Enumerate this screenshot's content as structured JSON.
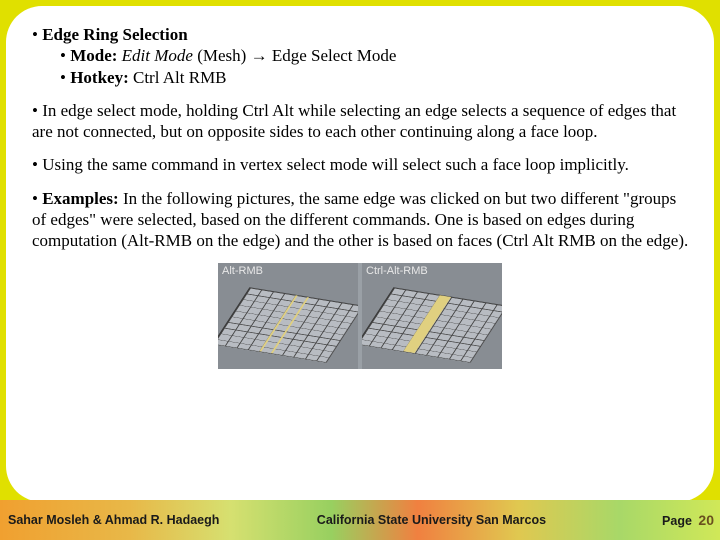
{
  "slide": {
    "b1_title": "Edge Ring Selection",
    "b1_sub1_label": "Mode:",
    "b1_sub1_emph": "Edit Mode",
    "b1_sub1_rest": "(Mesh) → Edge Select Mode",
    "b1_sub2_label": "Hotkey:",
    "b1_sub2_rest": "Ctrl  Alt  RMB",
    "b2": "In edge select mode, holding Ctrl Alt while selecting an edge selects a sequence of edges that are not connected, but on opposite sides to each other continuing along a face loop.",
    "b3": "Using the same command in vertex select mode will select such a face loop implicitly.",
    "b4_label": "Examples:",
    "b4_rest": "In the following pictures, the same edge was clicked on but two different \"groups of edges\" were selected, based on the different commands. One is based on edges during computation (Alt-RMB on the edge) and the other is based on faces (Ctrl Alt RMB on the edge).",
    "fig_panel_left": "Alt-RMB",
    "fig_panel_right": "Ctrl-Alt-RMB"
  },
  "footer": {
    "left": "Sahar Mosleh & Ahmad R. Hadaegh",
    "mid": "California State University San Marcos",
    "page_label": "Page",
    "page_num": "20"
  }
}
